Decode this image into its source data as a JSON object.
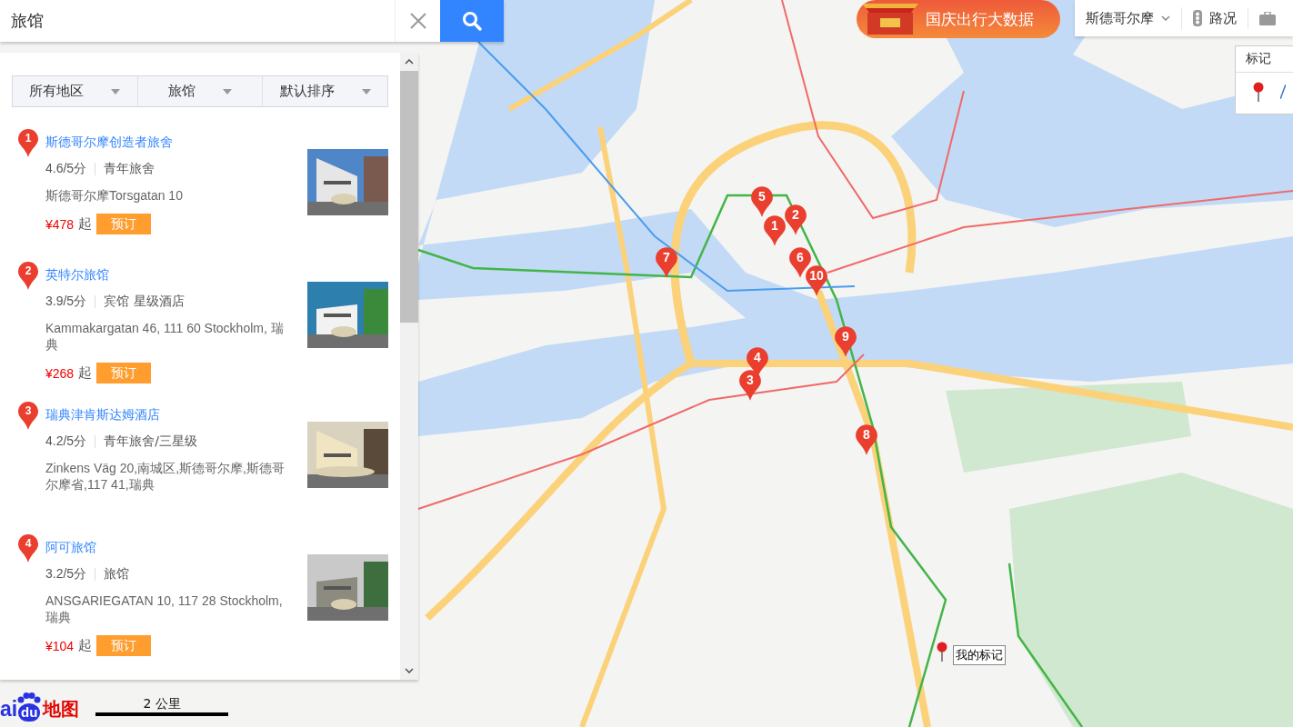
{
  "search": {
    "value": "旅馆"
  },
  "filters": [
    {
      "label": "所有地区"
    },
    {
      "label": "旅馆"
    },
    {
      "label": "默认排序"
    }
  ],
  "results": [
    {
      "number": "1",
      "name": "斯德哥尔摩创造者旅舍",
      "rating": "4.6/5分",
      "category": "青年旅舍",
      "address": "斯德哥尔摩Torsgatan 10",
      "price": "¥478",
      "price_suffix": "起",
      "action": "预订"
    },
    {
      "number": "2",
      "name": "英特尔旅馆",
      "rating": "3.9/5分",
      "category": "宾馆 星级酒店",
      "address": "Kammakargatan 46, 111 60 Stockholm, 瑞典",
      "price": "¥268",
      "price_suffix": "起",
      "action": "预订"
    },
    {
      "number": "3",
      "name": "瑞典津肯斯达姆酒店",
      "rating": "4.2/5分",
      "category": "青年旅舍/三星级",
      "address": "Zinkens Väg 20,南城区,斯德哥尔摩,斯德哥尔摩省,117 41,瑞典"
    },
    {
      "number": "4",
      "name": "阿可旅馆",
      "rating": "3.2/5分",
      "category": "旅馆",
      "address": "ANSGARIEGATAN 10, 117 28 Stockholm, 瑞典",
      "price": "¥104",
      "price_suffix": "起",
      "action": "预订"
    }
  ],
  "banner": {
    "label": "国庆出行大数据"
  },
  "toolbar": {
    "city": "斯德哥尔摩",
    "traffic": "路况"
  },
  "marker_panel": {
    "title": "标记"
  },
  "map": {
    "pins": [
      {
        "label": "1"
      },
      {
        "label": "2"
      },
      {
        "label": "3"
      },
      {
        "label": "4"
      },
      {
        "label": "5"
      },
      {
        "label": "6"
      },
      {
        "label": "7"
      },
      {
        "label": "8"
      },
      {
        "label": "9"
      },
      {
        "label": "10"
      }
    ],
    "my_marker": {
      "label": "我的标记"
    }
  },
  "logo": {
    "part_1": "ai",
    "part_2": "du",
    "part_3": "地图"
  },
  "scale": {
    "label": "2 公里"
  }
}
